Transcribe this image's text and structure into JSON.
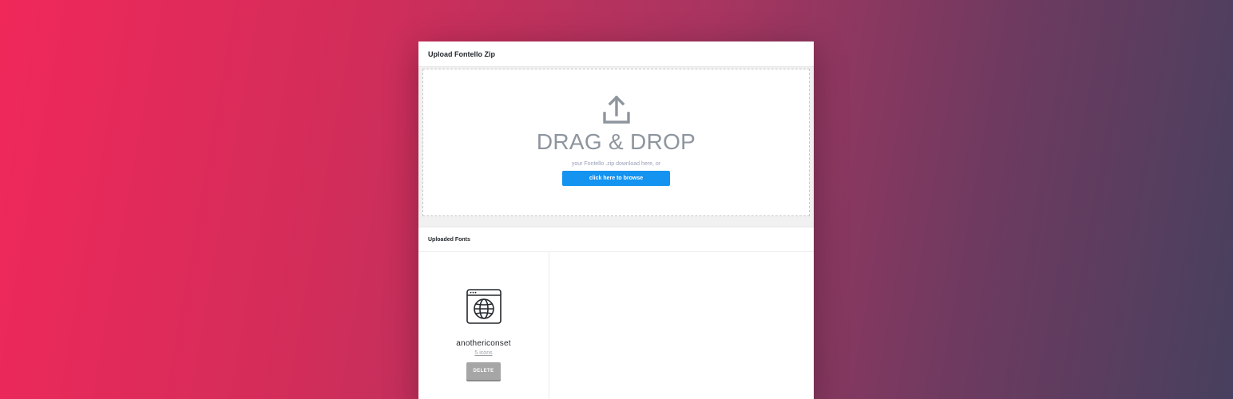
{
  "upload_panel": {
    "title": "Upload Fontello Zip",
    "dropzone": {
      "icon": "upload-icon",
      "heading": "DRAG & DROP",
      "subtext": "your Fontello .zip download here, or",
      "browse_label": "click here to browse"
    }
  },
  "uploaded_fonts": {
    "title": "Uploaded Fonts",
    "items": [
      {
        "icon": "globe-window-icon",
        "name": "anothericonset",
        "count_label": "5 icons",
        "delete_label": "DELETE"
      }
    ]
  },
  "colors": {
    "accent": "#1493f0",
    "drag_text": "#8e959e",
    "delete_button": "#a6a6a6",
    "background_left": "#f0285a",
    "background_right": "#47405e"
  }
}
